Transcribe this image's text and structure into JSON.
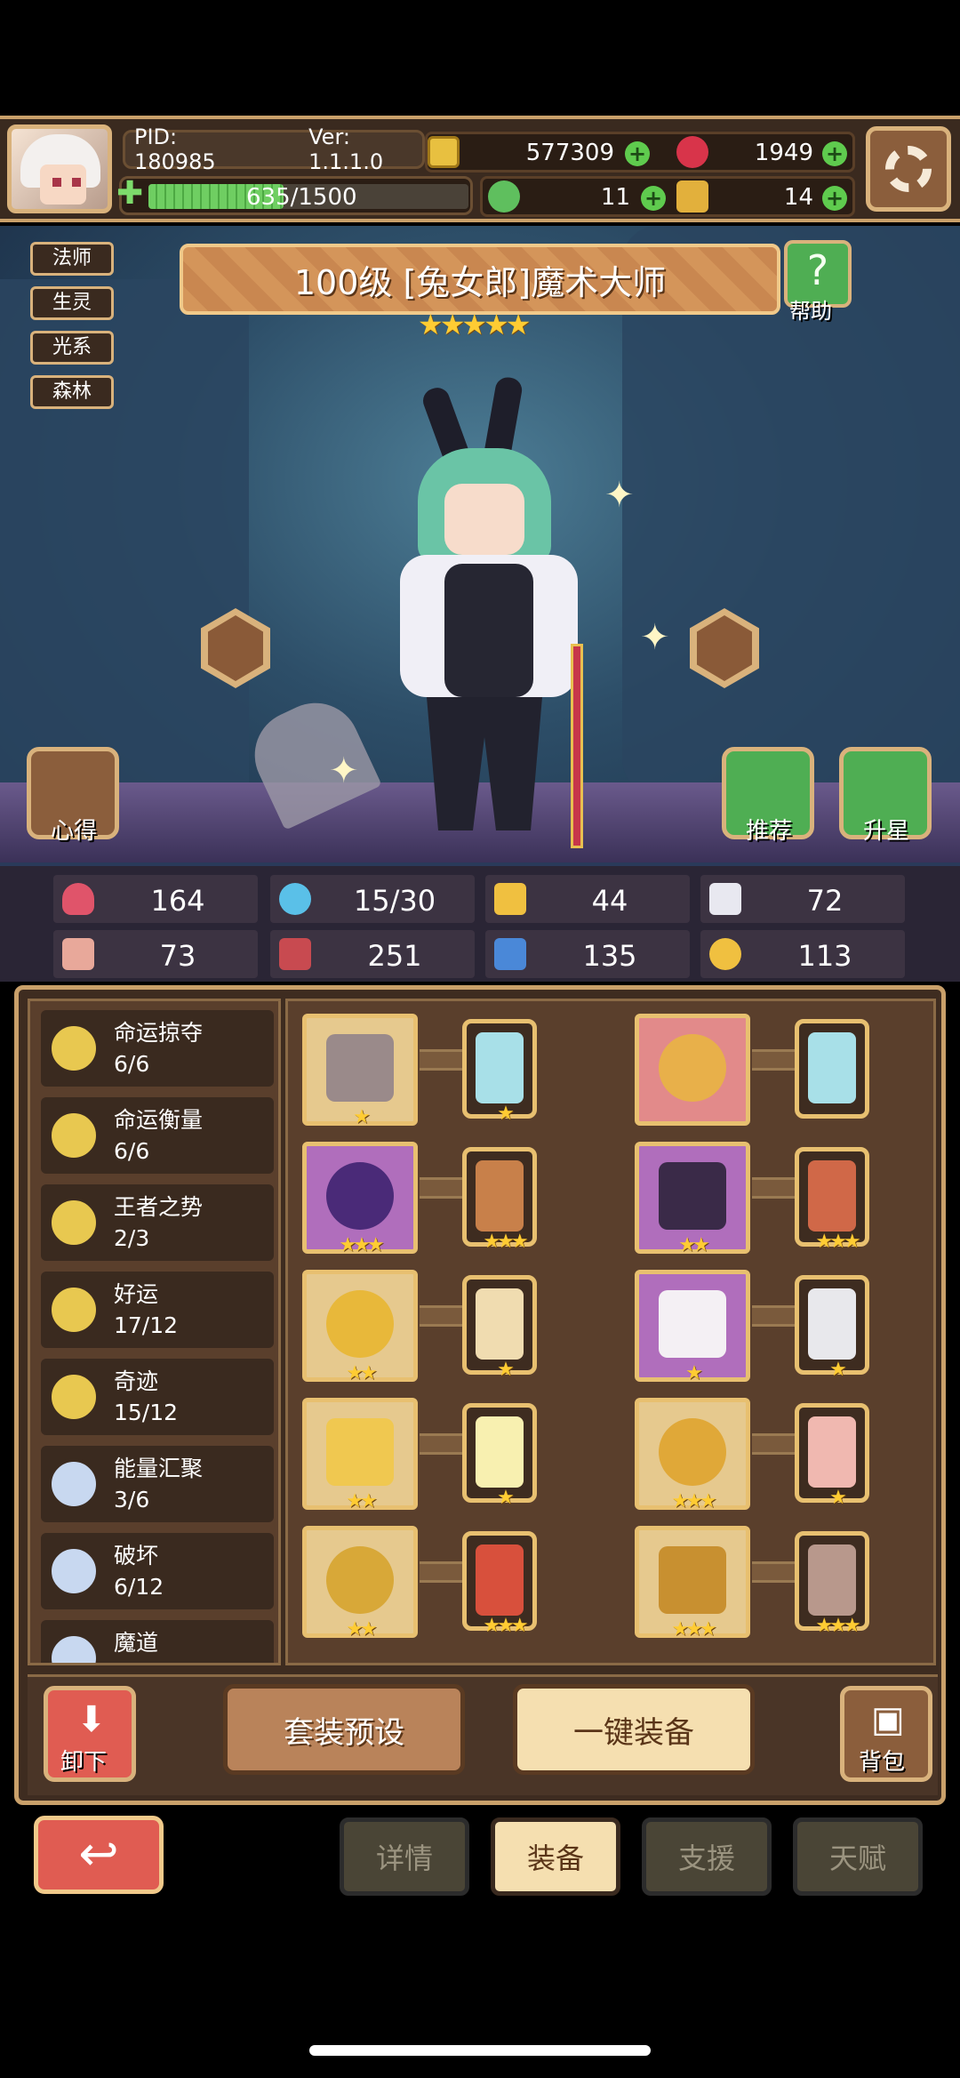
{
  "header": {
    "pid": "PID: 180985",
    "version": "Ver: 1.1.1.0",
    "exp": "635/1500",
    "exp_fraction": 0.423,
    "gold": "577309",
    "gems": "1949",
    "clover": "11",
    "keys": "14"
  },
  "tags": [
    "法师",
    "生灵",
    "光系",
    "森林"
  ],
  "hero": {
    "title": "100级 [兔女郎]魔术大师",
    "stars": "★★★★★",
    "help_label": "帮助"
  },
  "actions": {
    "insight_label": "心得",
    "recommend_label": "推荐",
    "starup_label": "升星"
  },
  "stats": {
    "hp": "164",
    "mana": "15/30",
    "defense": "44",
    "speed": "72",
    "attack": "73",
    "magic": "251",
    "resist": "135",
    "luck": "113"
  },
  "sets": [
    {
      "name": "命运掠夺",
      "count": "6/6"
    },
    {
      "name": "命运衡量",
      "count": "6/6"
    },
    {
      "name": "王者之势",
      "count": "2/3"
    },
    {
      "name": "好运",
      "count": "17/12"
    },
    {
      "name": "奇迹",
      "count": "15/12"
    },
    {
      "name": "能量汇聚",
      "count": "3/6"
    },
    {
      "name": "破坏",
      "count": "6/12"
    },
    {
      "name": "魔道",
      "count": ""
    }
  ],
  "equip_stars": {
    "r1a": "★",
    "r1b": "★",
    "r1c": "",
    "r1d": "",
    "r2a": "★★★",
    "r2b": "★★★",
    "r2c": "★★",
    "r2d": "★★★",
    "r3a": "★★",
    "r3b": "★",
    "r3c": "★",
    "r3d": "★",
    "r4a": "★★",
    "r4b": "★",
    "r4c": "★★★",
    "r4d": "★",
    "r5a": "★★",
    "r5b": "★★★",
    "r5c": "★★★",
    "r5d": "★★★"
  },
  "buttons": {
    "unequip": "卸下",
    "preset": "套装预设",
    "equip_all": "一键装备",
    "bag": "背包"
  },
  "tabs": {
    "details": "详情",
    "equip": "装备",
    "support": "支援",
    "talent": "天赋"
  }
}
